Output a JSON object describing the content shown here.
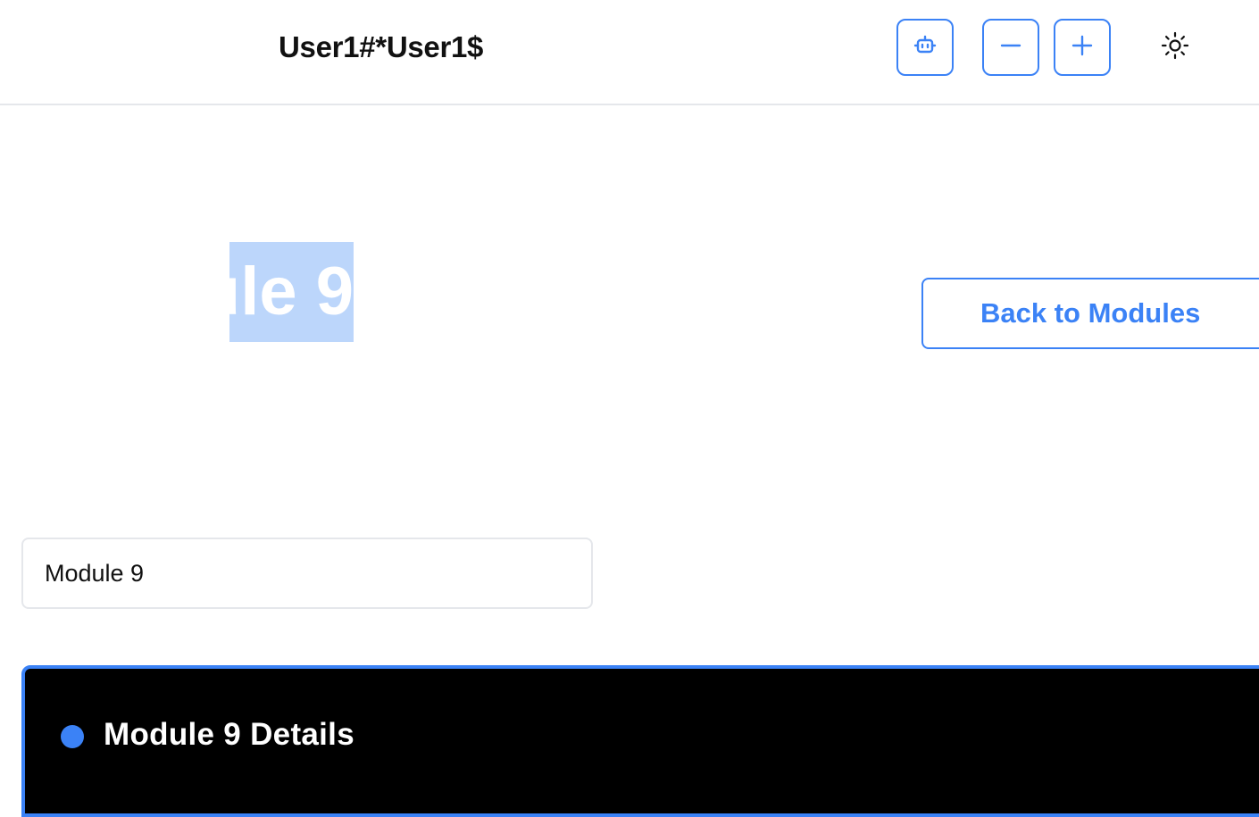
{
  "header": {
    "user_title": "User1#*User1$",
    "colors": {
      "accent": "#3b82f6",
      "border": "#e5e7eb"
    },
    "icons": {
      "bot": "robot-icon",
      "minus": "minus-icon",
      "plus": "plus-icon",
      "theme": "sun-icon"
    }
  },
  "main": {
    "heading": "Module 9",
    "heading_selection_color": "#bcd6fb",
    "back_button_label": "Back to Modules",
    "name_field_value": "Module 9"
  },
  "details": {
    "title": "Module 9 Details",
    "background": "#000000",
    "dot_color": "#3b82f6"
  }
}
